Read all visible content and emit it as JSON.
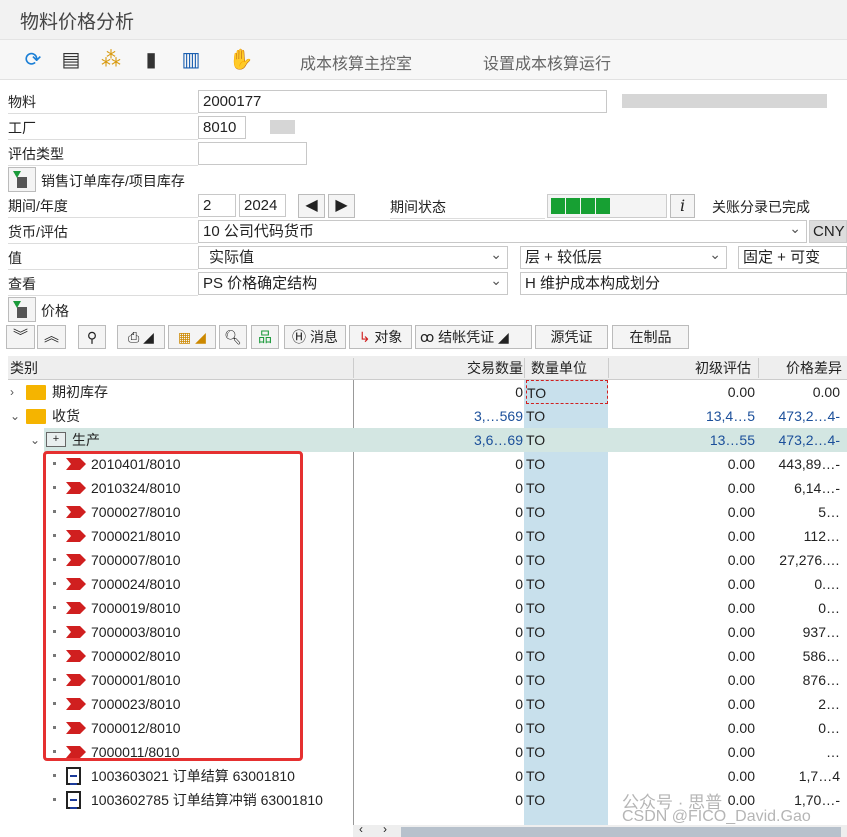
{
  "window": {
    "title": "物料价格分析"
  },
  "toolbar": {
    "icons": [
      "refresh-icon",
      "layout-icon",
      "hierarchy-icon",
      "columns-icon",
      "grid-icon",
      "hand-icon"
    ],
    "buttons": [
      "成本核算主控室",
      "设置成本核算运行"
    ]
  },
  "form": {
    "material": {
      "label": "物料",
      "value": "2000177"
    },
    "plant": {
      "label": "工厂",
      "value": "8010"
    },
    "valuation_type": {
      "label": "评估类型",
      "value": ""
    },
    "sales_order_stock": {
      "label": "销售订单库存/项目库存"
    },
    "period_year": {
      "label": "期间/年度",
      "period": "2",
      "year": "2024"
    },
    "period_status": {
      "label": "期间状态",
      "status_text": "关账分录已完成",
      "status_color": "#17a033"
    },
    "currency": {
      "label": "货币/评估",
      "value": "10 公司代码货币",
      "currency": "CNY"
    },
    "value": {
      "label": "值",
      "value": "实际值",
      "level": "层 + 较低层",
      "fixed": "固定 + 可变"
    },
    "view": {
      "label": "查看",
      "value": "PS 价格确定结构",
      "cost_component": "H 维护成本构成划分"
    },
    "price": {
      "label": "价格"
    }
  },
  "grid_toolbar": {
    "buttons": [
      "消息",
      "对象",
      "结帐凭证",
      "源凭证",
      "在制品"
    ]
  },
  "grid": {
    "columns": [
      "类别",
      "交易数量",
      "数量单位",
      "初级评估",
      "价格差异"
    ],
    "rows": [
      {
        "level": 0,
        "icon": "folder-icon",
        "expand": "collapsed",
        "label": "期初库存",
        "qty": "0",
        "uom": "TO",
        "prelim": "0.00",
        "diff": "0.00"
      },
      {
        "level": 0,
        "icon": "folder-open-icon",
        "expand": "expanded",
        "label": "收货",
        "qty": "3,…569",
        "uom": "TO",
        "prelim": "13,4…5",
        "diff": "473,2…4-"
      },
      {
        "level": 1,
        "icon": "production-icon",
        "expand": "expanded",
        "label": "生产",
        "qty": "3,6…69",
        "uom": "TO",
        "prelim": "13…55",
        "diff": "473,2…4-"
      },
      {
        "level": 2,
        "icon": "order-arrow-icon",
        "label": "2010401/8010",
        "qty": "0",
        "uom": "TO",
        "prelim": "0.00",
        "diff": "443,89…-"
      },
      {
        "level": 2,
        "icon": "order-arrow-icon",
        "label": "2010324/8010",
        "qty": "0",
        "uom": "TO",
        "prelim": "0.00",
        "diff": "6,14…-"
      },
      {
        "level": 2,
        "icon": "order-arrow-icon",
        "label": "7000027/8010",
        "qty": "0",
        "uom": "TO",
        "prelim": "0.00",
        "diff": "5…"
      },
      {
        "level": 2,
        "icon": "order-arrow-icon",
        "label": "7000021/8010",
        "qty": "0",
        "uom": "TO",
        "prelim": "0.00",
        "diff": "112…"
      },
      {
        "level": 2,
        "icon": "order-arrow-icon",
        "label": "7000007/8010",
        "qty": "0",
        "uom": "TO",
        "prelim": "0.00",
        "diff": "27,276.…"
      },
      {
        "level": 2,
        "icon": "order-arrow-icon",
        "label": "7000024/8010",
        "qty": "0",
        "uom": "TO",
        "prelim": "0.00",
        "diff": "0.…"
      },
      {
        "level": 2,
        "icon": "order-arrow-icon",
        "label": "7000019/8010",
        "qty": "0",
        "uom": "TO",
        "prelim": "0.00",
        "diff": "0…"
      },
      {
        "level": 2,
        "icon": "order-arrow-icon",
        "label": "7000003/8010",
        "qty": "0",
        "uom": "TO",
        "prelim": "0.00",
        "diff": "937…"
      },
      {
        "level": 2,
        "icon": "order-arrow-icon",
        "label": "7000002/8010",
        "qty": "0",
        "uom": "TO",
        "prelim": "0.00",
        "diff": "586…"
      },
      {
        "level": 2,
        "icon": "order-arrow-icon",
        "label": "7000001/8010",
        "qty": "0",
        "uom": "TO",
        "prelim": "0.00",
        "diff": "876…"
      },
      {
        "level": 2,
        "icon": "order-arrow-icon",
        "label": "7000023/8010",
        "qty": "0",
        "uom": "TO",
        "prelim": "0.00",
        "diff": "2…"
      },
      {
        "level": 2,
        "icon": "order-arrow-icon",
        "label": "7000012/8010",
        "qty": "0",
        "uom": "TO",
        "prelim": "0.00",
        "diff": "0…"
      },
      {
        "level": 2,
        "icon": "order-arrow-icon",
        "label": "7000011/8010",
        "qty": "0",
        "uom": "TO",
        "prelim": "0.00",
        "diff": "…"
      },
      {
        "level": 2,
        "icon": "document-icon",
        "label": "1003603021 订单结算 63001810",
        "qty": "0",
        "uom": "TO",
        "prelim": "0.00",
        "diff": "1,7…4"
      },
      {
        "level": 2,
        "icon": "document-icon",
        "label": "1003602785 订单结算冲销 63001810",
        "qty": "0",
        "uom": "TO",
        "prelim": "0.00",
        "diff": "1,70…-"
      }
    ]
  },
  "highlight_color": "#e53030",
  "watermark": {
    "line1": "公众号 · 思普",
    "line2": "CSDN @FICO_David.Gao"
  }
}
